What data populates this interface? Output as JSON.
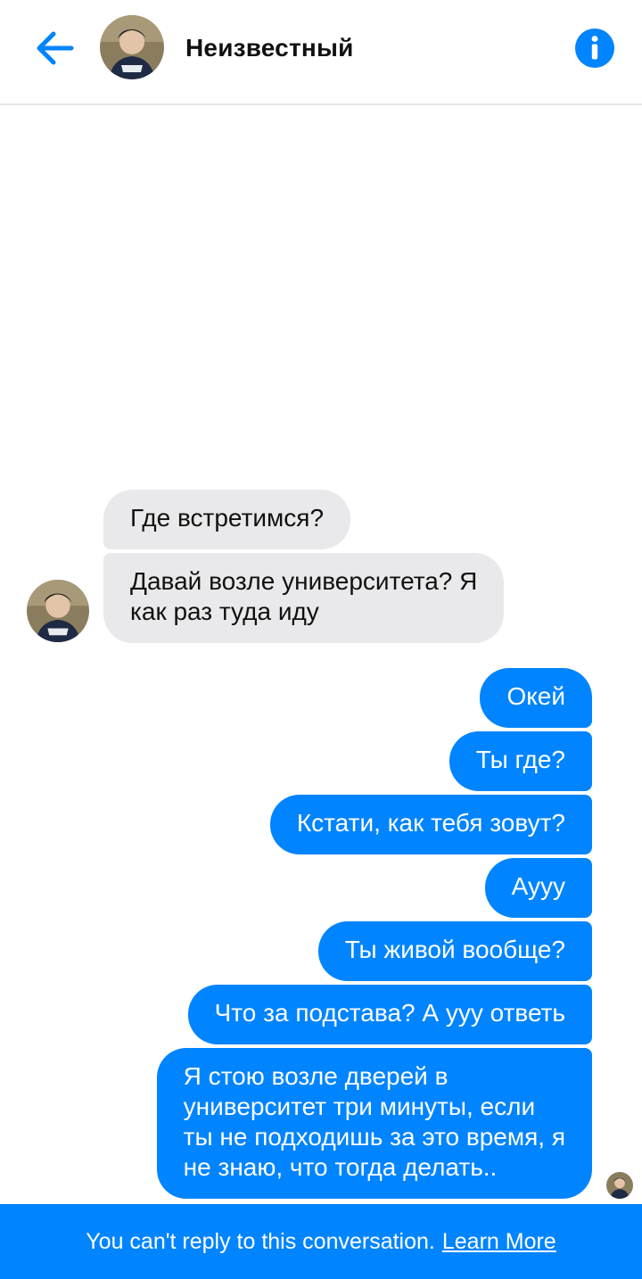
{
  "header": {
    "contact_name": "Неизвестный",
    "back_icon": "arrow-left-icon",
    "info_icon": "info-icon"
  },
  "messages": [
    {
      "direction": "incoming",
      "text": "Где встретимся?"
    },
    {
      "direction": "incoming",
      "text": "Давай возле университета? Я\nкак раз туда иду"
    },
    {
      "direction": "outgoing",
      "text": "Окей"
    },
    {
      "direction": "outgoing",
      "text": "Ты где?"
    },
    {
      "direction": "outgoing",
      "text": "Кстати, как тебя зовут?"
    },
    {
      "direction": "outgoing",
      "text": "Аууу"
    },
    {
      "direction": "outgoing",
      "text": "Ты живой вообще?"
    },
    {
      "direction": "outgoing",
      "text": "Что за подстава? А ууу ответь"
    },
    {
      "direction": "outgoing",
      "text": "Я стою возле дверей в\nуниверситет три минуты, если\nты не подходишь за это время, я\nне знаю, что тогда делать.."
    }
  ],
  "footer": {
    "notice": "You can't reply to this conversation.",
    "link": "Learn More"
  },
  "colors": {
    "accent": "#0084ff",
    "incoming_bubble": "#e9e9eb",
    "header_border": "#e6e6e6"
  }
}
